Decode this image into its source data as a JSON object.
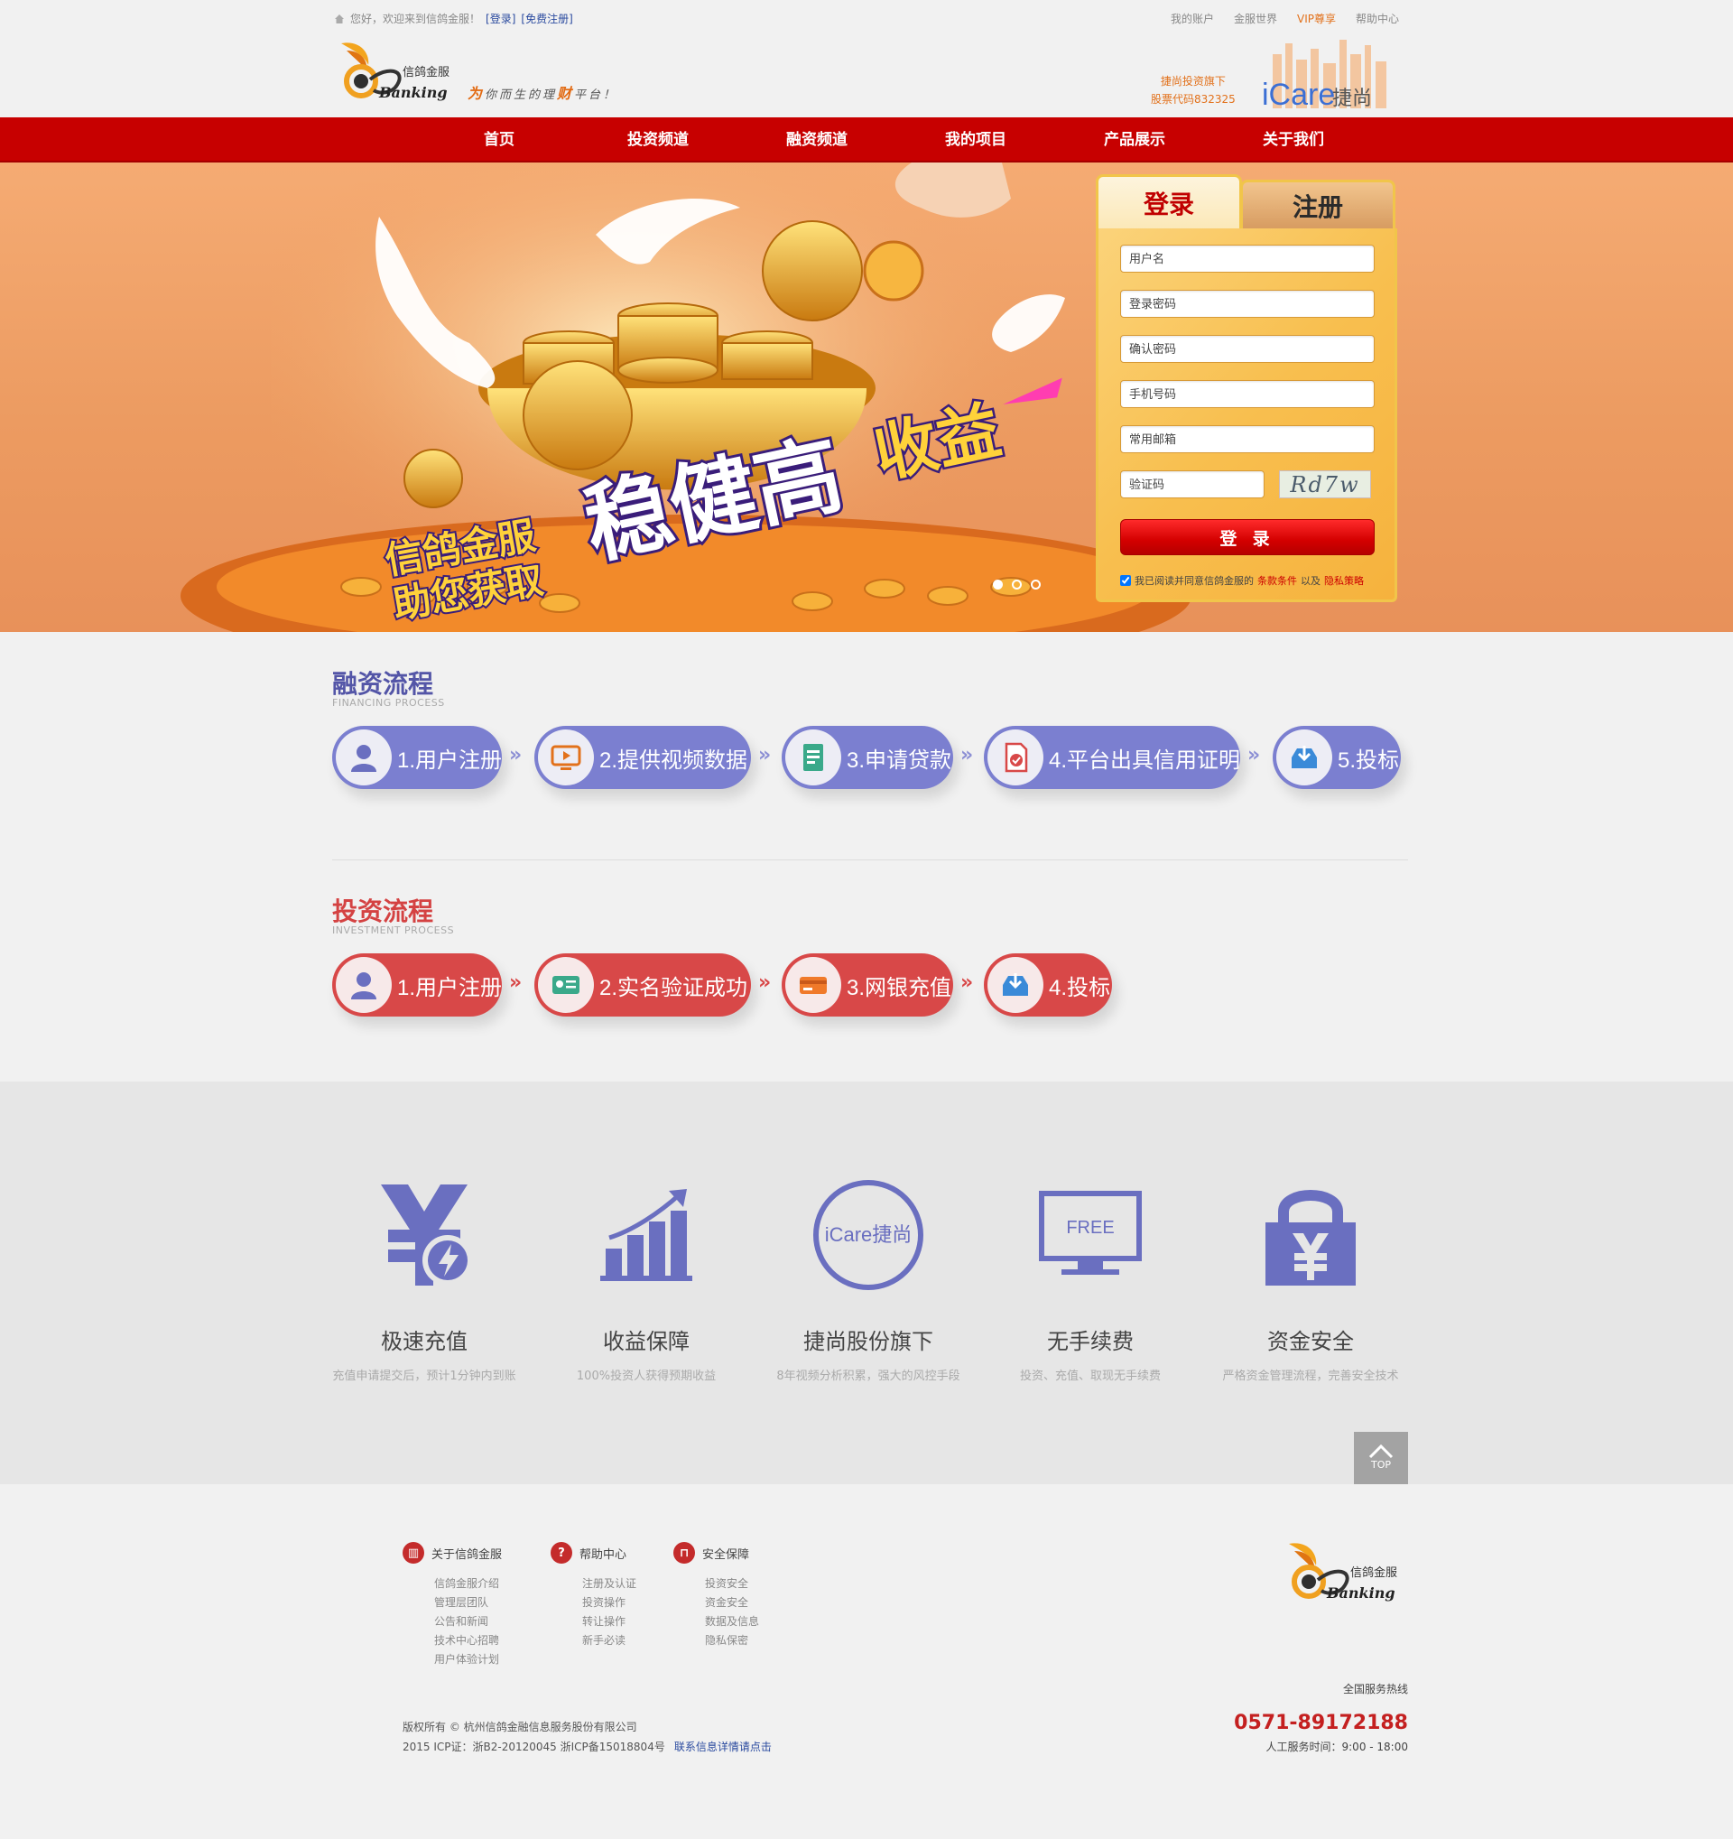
{
  "header": {
    "welcome": "您好，欢迎来到信鸽金服！",
    "login_link": "[登录]",
    "register_link": "[免费注册]",
    "top_links": [
      "我的账户",
      "金服世界",
      "VIP尊享",
      "帮助中心"
    ],
    "logo_brand": "信鸽金服",
    "logo_script": "Banking",
    "slogan_prefix": "为",
    "slogan_highlight": "财",
    "slogan_mid": "你而生的理",
    "slogan_suffix": "平台！",
    "stock_line1": "捷尚投资旗下",
    "stock_line2": "股票代码832325",
    "icare_brand": "iCare",
    "icare_cn": "捷尚"
  },
  "nav": {
    "items": [
      "首页",
      "投资频道",
      "融资频道",
      "我的项目",
      "产品展示",
      "关于我们"
    ]
  },
  "banner": {
    "headline_main": "稳健高",
    "headline_accent": "收益",
    "headline_line1": "信鸽金服",
    "headline_line2": "助您获取",
    "active_dot": 0,
    "dot_count": 3
  },
  "login": {
    "tab_login": "登录",
    "tab_register": "注册",
    "placeholders": {
      "username": "用户名",
      "password": "登录密码",
      "confirm": "确认密码",
      "phone": "手机号码",
      "email": "常用邮箱",
      "captcha": "验证码"
    },
    "captcha_text": "Rd7w",
    "submit": "登 录",
    "agree_prefix": "我已阅读并同意信鸽金服的",
    "agree_terms": "条款条件",
    "agree_and": "以及",
    "agree_privacy": "隐私策略"
  },
  "financing": {
    "title": "融资流程",
    "subtitle": "FINANCING PROCESS",
    "steps": [
      "1.用户注册",
      "2.提供视频数据",
      "3.申请贷款",
      "4.平台出具信用证明",
      "5.投标"
    ]
  },
  "investment": {
    "title": "投资流程",
    "subtitle": "INVESTMENT PROCESS",
    "steps": [
      "1.用户注册",
      "2.实名验证成功",
      "3.网银充值",
      "4.投标"
    ]
  },
  "features": [
    {
      "title": "极速充值",
      "desc": "充值申请提交后，预计1分钟内到账",
      "icon": "yen-lightning-icon"
    },
    {
      "title": "收益保障",
      "desc": "100%投资人获得预期收益",
      "icon": "growth-chart-icon"
    },
    {
      "title": "捷尚股份旗下",
      "desc": "8年视频分析积累，强大的风控手段",
      "icon": "icare-circle-icon",
      "icon_text": "iCare捷尚"
    },
    {
      "title": "无手续费",
      "desc": "投资、充值、取现无手续费",
      "icon": "free-monitor-icon",
      "icon_text": "FREE"
    },
    {
      "title": "资金安全",
      "desc": "严格资金管理流程，完善安全技术",
      "icon": "lock-yen-icon"
    }
  ],
  "totop": "TOP",
  "footer": {
    "columns": [
      {
        "title": "关于信鸽金服",
        "icon": "bank-icon",
        "items": [
          "信鸽金服介绍",
          "管理层团队",
          "公告和新闻",
          "技术中心招聘",
          "用户体验计划"
        ]
      },
      {
        "title": "帮助中心",
        "icon": "question-icon",
        "items": [
          "注册及认证",
          "投资操作",
          "转让操作",
          "新手必读"
        ]
      },
      {
        "title": "安全保障",
        "icon": "lock-icon",
        "items": [
          "投资安全",
          "资金安全",
          "数据及信息",
          "隐私保密"
        ]
      }
    ],
    "copyright": "版权所有 © 杭州信鸽金融信息服务股份有限公司",
    "icp": "2015  ICP证：浙B2-20120045  浙ICP备15018804号",
    "contact_link": "联系信息详情请点击",
    "hotline_label": "全国服务热线",
    "hotline": "0571-89172188",
    "hours": "人工服务时间：9:00 - 18:00"
  },
  "colors": {
    "brand_red": "#c70000",
    "financing_purple": "#7b7fd0",
    "investment_red": "#d84848",
    "feature_icon": "#6a6fc0",
    "vip_orange": "#e2711b"
  }
}
